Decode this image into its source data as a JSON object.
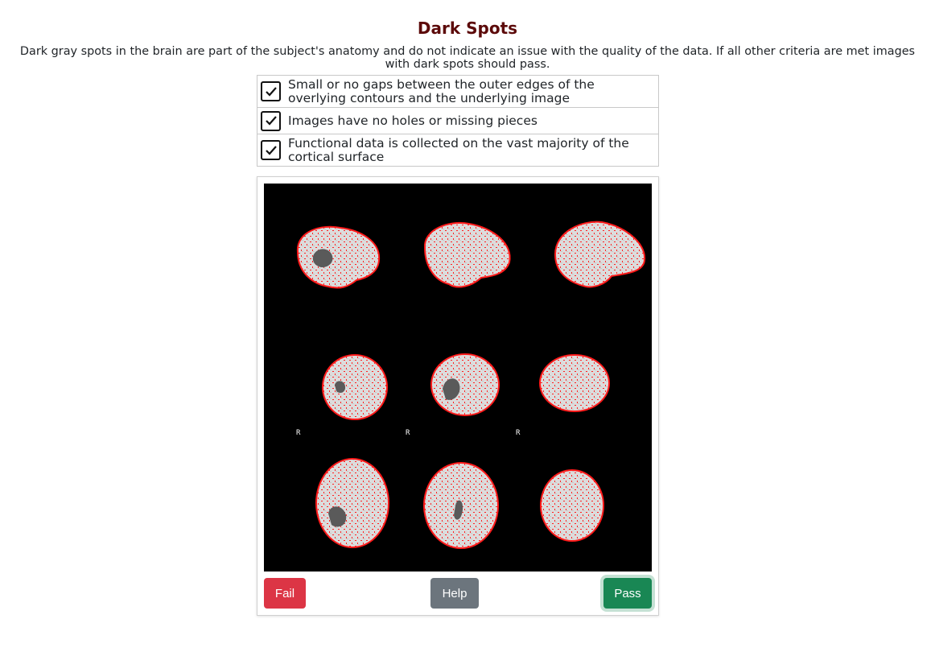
{
  "page": {
    "title": "Dark Spots",
    "description": "Dark gray spots in the brain are part of the subject's anatomy and do not indicate an issue with the quality of the data. If all other criteria are met images with dark spots should pass."
  },
  "criteria": [
    {
      "label": "Small or no gaps between the outer edges of the overlying contours and the underlying image",
      "checked": true
    },
    {
      "label": "Images have no holes or missing pieces",
      "checked": true
    },
    {
      "label": "Functional data is collected on the vast majority of the cortical surface",
      "checked": true
    }
  ],
  "viewer": {
    "orientation_labels": [
      "R",
      "R",
      "R"
    ],
    "colors": {
      "background": "#000000",
      "brain": "#d9d9d9",
      "contour": "#ff1a1a",
      "spot": "#5a5a5a"
    }
  },
  "buttons": {
    "fail_label": "Fail",
    "help_label": "Help",
    "pass_label": "Pass",
    "colors": {
      "fail": "#dc3545",
      "help": "#6c757d",
      "pass": "#198754"
    }
  }
}
